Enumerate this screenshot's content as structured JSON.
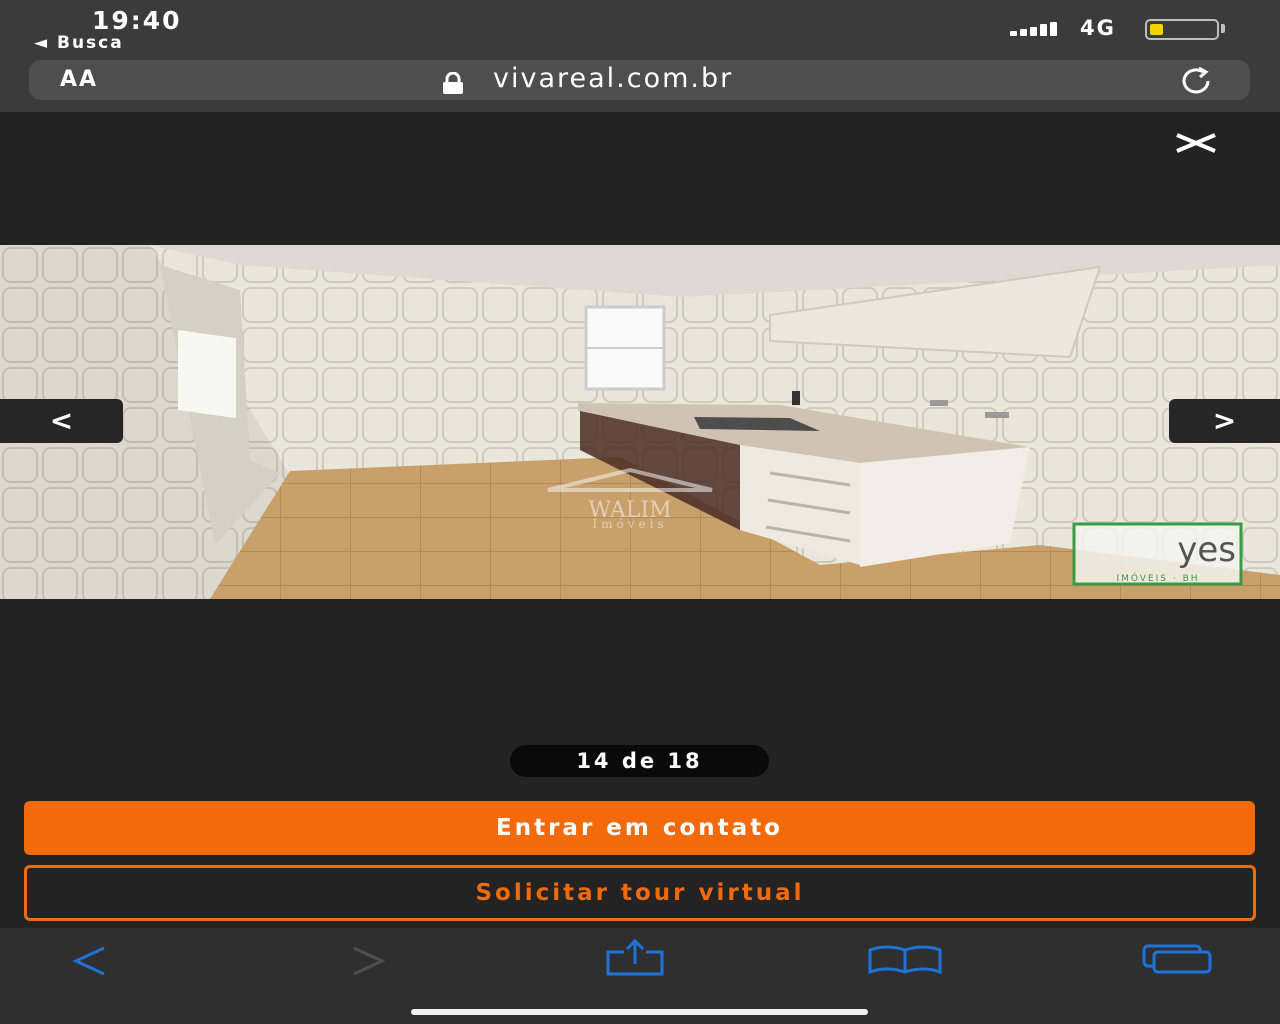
{
  "status": {
    "time": "19:40",
    "back_app": "◄ Busca",
    "network": "4G",
    "battery_level": 0.2,
    "signal_bars": 4
  },
  "address": {
    "aa_label": "AA",
    "url": "vivareal.com.br"
  },
  "gallery": {
    "prev_label": "<",
    "next_label": ">",
    "counter": "14 de 18",
    "watermark_brand": "yes",
    "watermark_sub": "IMÓVEIS · BH",
    "watermark_center": "WALIM",
    "watermark_center_sub": "Imóveis"
  },
  "actions": {
    "contact_label": "Entrar em contato",
    "tour_label": "Solicitar tour virtual"
  },
  "colors": {
    "accent": "#f26a0c",
    "toolbar_icon": "#1f72d8"
  }
}
